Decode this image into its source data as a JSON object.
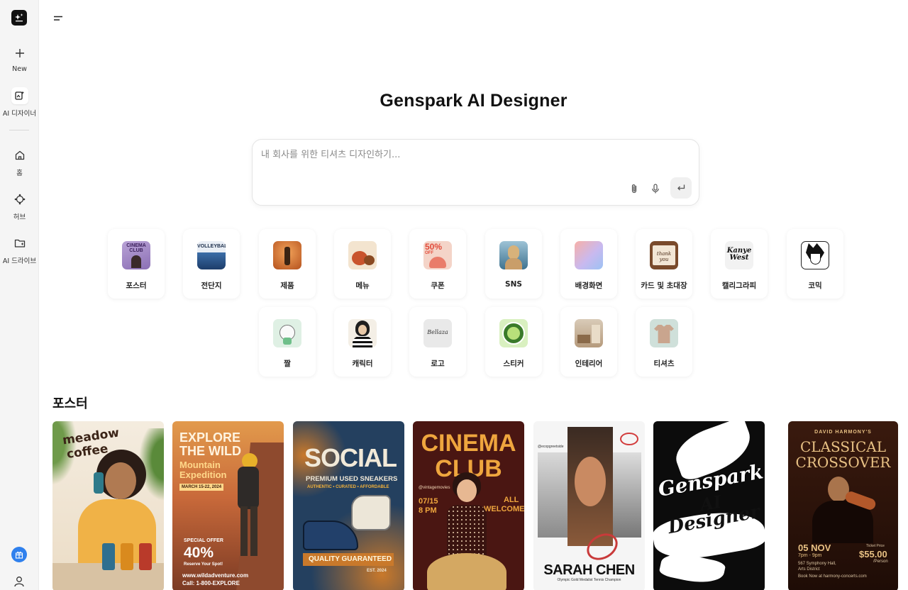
{
  "sidebar": {
    "items": [
      {
        "label": "New",
        "icon": "plus-icon"
      },
      {
        "label": "AI 디자이너",
        "icon": "ai-designer-icon"
      },
      {
        "label": "홈",
        "icon": "home-icon"
      },
      {
        "label": "허브",
        "icon": "hub-icon"
      },
      {
        "label": "AI 드라이브",
        "icon": "folder-icon"
      }
    ]
  },
  "main": {
    "title": "Genspark AI Designer",
    "prompt": {
      "placeholder": "내 회사를 위한 티셔츠 디자인하기..."
    },
    "categories": [
      {
        "label": "포스터"
      },
      {
        "label": "전단지"
      },
      {
        "label": "제품"
      },
      {
        "label": "메뉴"
      },
      {
        "label": "쿠폰"
      },
      {
        "label": "SNS"
      },
      {
        "label": "배경화면"
      },
      {
        "label": "카드 및 초대장"
      },
      {
        "label": "캘리그라피"
      },
      {
        "label": "코믹"
      },
      {
        "label": "짤"
      },
      {
        "label": "캐릭터"
      },
      {
        "label": "로고"
      },
      {
        "label": "스티커"
      },
      {
        "label": "인테리어"
      },
      {
        "label": "티셔츠"
      }
    ],
    "thumb_text": {
      "poster": "CINEMA CLUB",
      "flyer": "VOLLEYBALL",
      "coupon_pct": "50%",
      "coupon_off": "OFF",
      "card": "thank you",
      "calli": "Kanye West",
      "logo": "Bellaza"
    },
    "section_title": "포스터",
    "posters": [
      {
        "lines": [
          "meadow",
          "coffee"
        ]
      },
      {
        "lines": [
          "EXPLORE",
          "THE WILD",
          "Mountain",
          "Expedition",
          "MARCH 15-22, 2024",
          "SPECIAL OFFER",
          "40%",
          "Reserve Your Spot!",
          "www.wildadventure.com",
          "Call: 1-800-EXPLORE"
        ]
      },
      {
        "lines": [
          "SOCIAL",
          "PREMIUM USED SNEAKERS",
          "AUTHENTIC • CURATED • AFFORDABLE",
          "QUALITY GUARANTEED",
          "EST. 2024"
        ]
      },
      {
        "lines": [
          "CINEMA",
          "CLUB",
          "@vintagemovies",
          "07/15",
          "8 PM",
          "ALL",
          "WELCOME"
        ]
      },
      {
        "lines": [
          "SARAH CHEN",
          "Olympic Gold Medalist Tennis Champion",
          "@ecopgreetside"
        ]
      },
      {
        "lines": [
          "Genspark",
          "AI",
          "Designer"
        ]
      },
      {
        "lines": [
          "DAVID HARMONY'S",
          "CLASSICAL",
          "CROSSOVER",
          "05 NOV",
          "7pm - 9pm",
          "567 Symphony Hall,",
          "Arts District",
          "Ticket Price",
          "$55.00",
          "/Person",
          "Book Now at harmony-concerts.com"
        ]
      }
    ]
  }
}
